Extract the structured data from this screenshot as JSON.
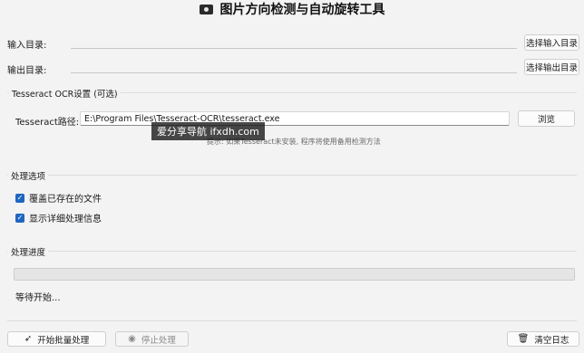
{
  "window": {
    "title": "图片方向检测与自动旋转工具"
  },
  "paths": {
    "input_label": "输入目录:",
    "input_value": "",
    "input_button": "选择输入目录",
    "output_label": "输出目录:",
    "output_value": "",
    "output_button": "选择输出目录"
  },
  "ocr": {
    "group_title": "Tesseract OCR设置 (可选)",
    "path_label": "Tesseract路径:",
    "path_value": "E:\\Program Files\\Tesseract-OCR\\tesseract.exe",
    "browse_button": "浏览",
    "hint": "提示: 如果Tesseract未安装, 程序将使用备用检测方法"
  },
  "options": {
    "group_title": "处理选项",
    "items": [
      {
        "label": "覆盖已存在的文件",
        "checked": true
      },
      {
        "label": "显示详细处理信息",
        "checked": true
      }
    ]
  },
  "progress": {
    "group_title": "处理进度",
    "value_fraction": 0,
    "status": "等待开始..."
  },
  "footer": {
    "start_button": "开始批量处理",
    "stop_button": "停止处理",
    "clear_button": "清空日志"
  },
  "overlay": {
    "watermark": "爱分享导航 ifxdh.com"
  },
  "icons": {
    "title": "camera-icon",
    "start": "rocket-icon",
    "stop": "stop-circle-icon",
    "clear": "trash-icon"
  },
  "colors": {
    "accent": "#1f66c1",
    "background": "#f3f3f3"
  }
}
